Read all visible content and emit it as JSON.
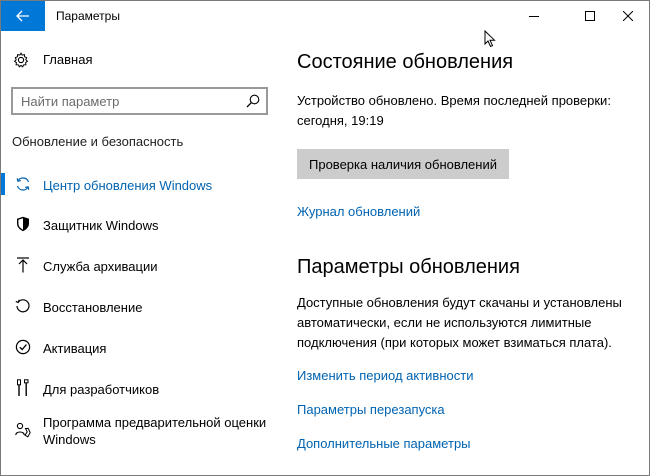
{
  "window": {
    "title": "Параметры"
  },
  "sidebar": {
    "home_label": "Главная",
    "search_placeholder": "Найти параметр",
    "section_title": "Обновление и безопасность",
    "items": [
      {
        "label": "Центр обновления Windows",
        "icon": "sync-icon",
        "active": true
      },
      {
        "label": "Защитник Windows",
        "icon": "shield-icon"
      },
      {
        "label": "Служба архивации",
        "icon": "backup-arrow-icon"
      },
      {
        "label": "Восстановление",
        "icon": "recovery-icon"
      },
      {
        "label": "Активация",
        "icon": "activation-check-icon"
      },
      {
        "label": "Для разработчиков",
        "icon": "developer-tools-icon"
      },
      {
        "label": "Программа предварительной оценки Windows",
        "icon": "insider-icon"
      }
    ]
  },
  "main": {
    "status_heading": "Состояние обновления",
    "status_text": "Устройство обновлено. Время последней проверки: сегодня, 19:19",
    "check_button": "Проверка наличия обновлений",
    "history_link": "Журнал обновлений",
    "settings_heading": "Параметры обновления",
    "settings_text": "Доступные обновления будут скачаны и установлены автоматически, если не используются лимитные подключения (при которых может взиматься плата).",
    "links": [
      "Изменить период активности",
      "Параметры перезапуска",
      "Дополнительные параметры"
    ]
  },
  "colors": {
    "accent": "#0078d7",
    "link": "#0063b1",
    "button_bg": "#cccccc"
  }
}
